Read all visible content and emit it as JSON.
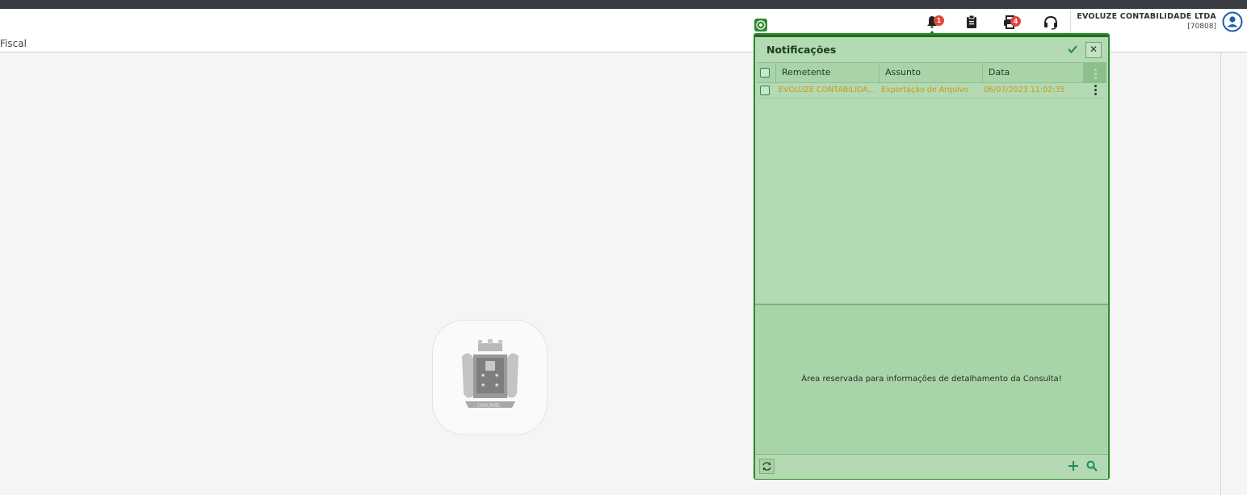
{
  "topbar": {
    "notifications_badge": "1",
    "printer_badge": "4",
    "company_name": "EVOLUZE CONTABILIDADE LTDA",
    "company_code": "[70808]"
  },
  "breadcrumb": "Fiscal",
  "logo": {
    "banner_text": "CASCAVEL"
  },
  "notifications": {
    "title": "Notificações",
    "columns": [
      "Remetente",
      "Assunto",
      "Data"
    ],
    "rows": [
      {
        "remetente": "EVOLUZE CONTABILIDADE LTDA",
        "assunto": "Exportação de Arquivo",
        "data": "06/07/2023 11:02:35"
      }
    ],
    "detail_placeholder": "Área reservada para informações de detalhamento da Consulta!"
  },
  "colors": {
    "panel_bg": "#b3dab3",
    "panel_border": "#2a8a2a",
    "row_text": "#c79a1c",
    "badge": "#e0483c",
    "accent": "#1d8a5a"
  }
}
